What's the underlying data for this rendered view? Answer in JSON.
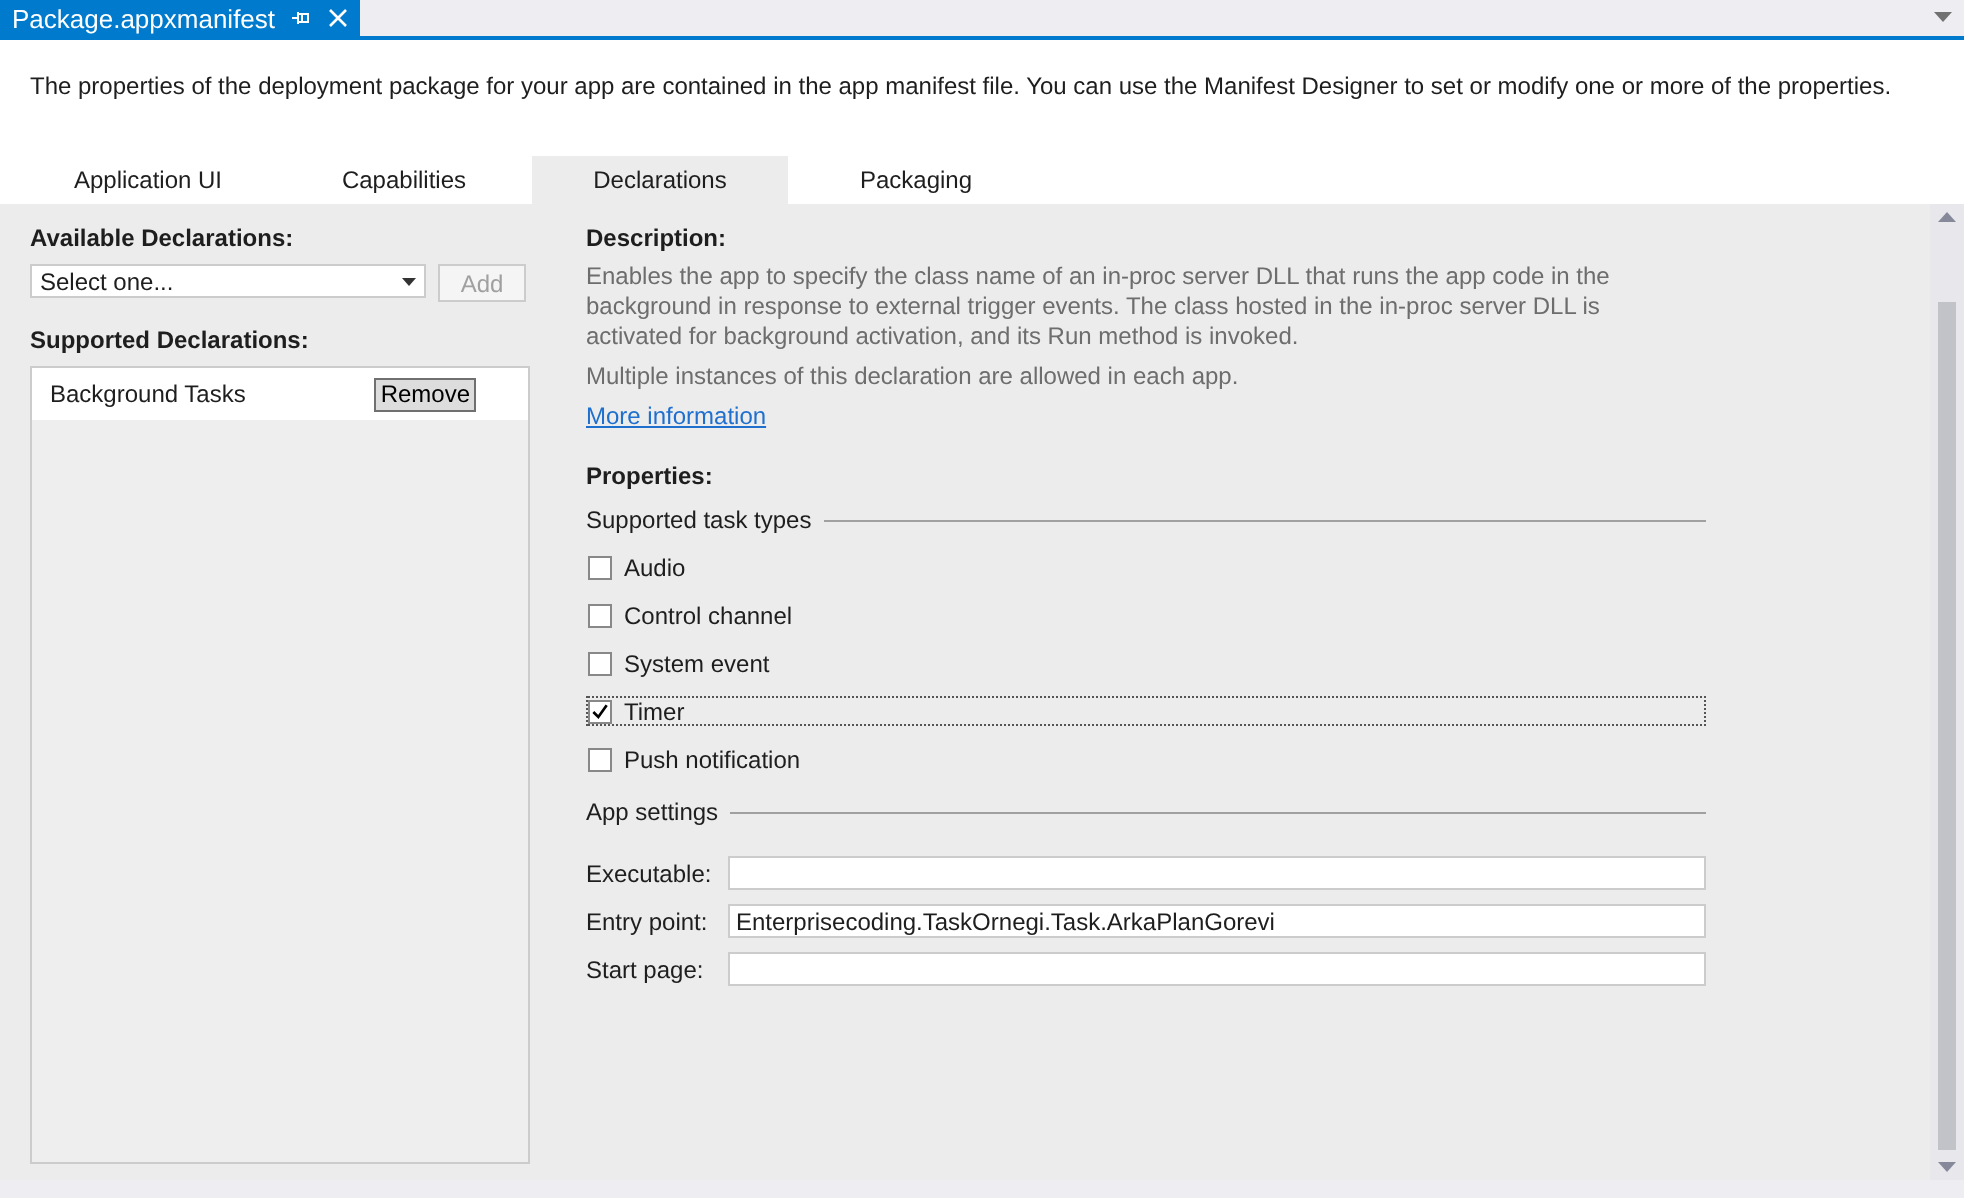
{
  "document_tab": {
    "title": "Package.appxmanifest",
    "selected": true
  },
  "intro": "The properties of the deployment package for your app are contained in the app manifest file. You can use the Manifest Designer to set or modify one or more of the properties.",
  "tabs": [
    {
      "label": "Application UI",
      "selected": false
    },
    {
      "label": "Capabilities",
      "selected": false
    },
    {
      "label": "Declarations",
      "selected": true
    },
    {
      "label": "Packaging",
      "selected": false
    }
  ],
  "available_declarations": {
    "heading": "Available Declarations:",
    "placeholder": "Select one...",
    "add_button": {
      "label": "Add",
      "disabled": true
    }
  },
  "supported_declarations": {
    "heading": "Supported Declarations:",
    "items": [
      {
        "name": "Background Tasks",
        "button": "Remove",
        "selected": true
      }
    ]
  },
  "description": {
    "heading": "Description:",
    "paragraphs": [
      "Enables the app to specify the class name of an in-proc server DLL that runs the app code in the background in response to external trigger events. The class hosted in the in-proc server DLL is activated for background activation, and its Run method is invoked.",
      "Multiple instances of this declaration are allowed in each app."
    ],
    "link": "More information"
  },
  "properties": {
    "heading": "Properties:",
    "task_types": {
      "legend": "Supported task types",
      "items": [
        {
          "label": "Audio",
          "checked": false,
          "focused": false
        },
        {
          "label": "Control channel",
          "checked": false,
          "focused": false
        },
        {
          "label": "System event",
          "checked": false,
          "focused": false
        },
        {
          "label": "Timer",
          "checked": true,
          "focused": true
        },
        {
          "label": "Push notification",
          "checked": false,
          "focused": false
        }
      ]
    },
    "app_settings": {
      "legend": "App settings",
      "fields": [
        {
          "label": "Executable:"
        },
        {
          "label": "Entry point:",
          "value": "Enterprisecoding.TaskOrnegi.Task.ArkaPlanGorevi"
        },
        {
          "label": "Start page:"
        }
      ]
    }
  }
}
